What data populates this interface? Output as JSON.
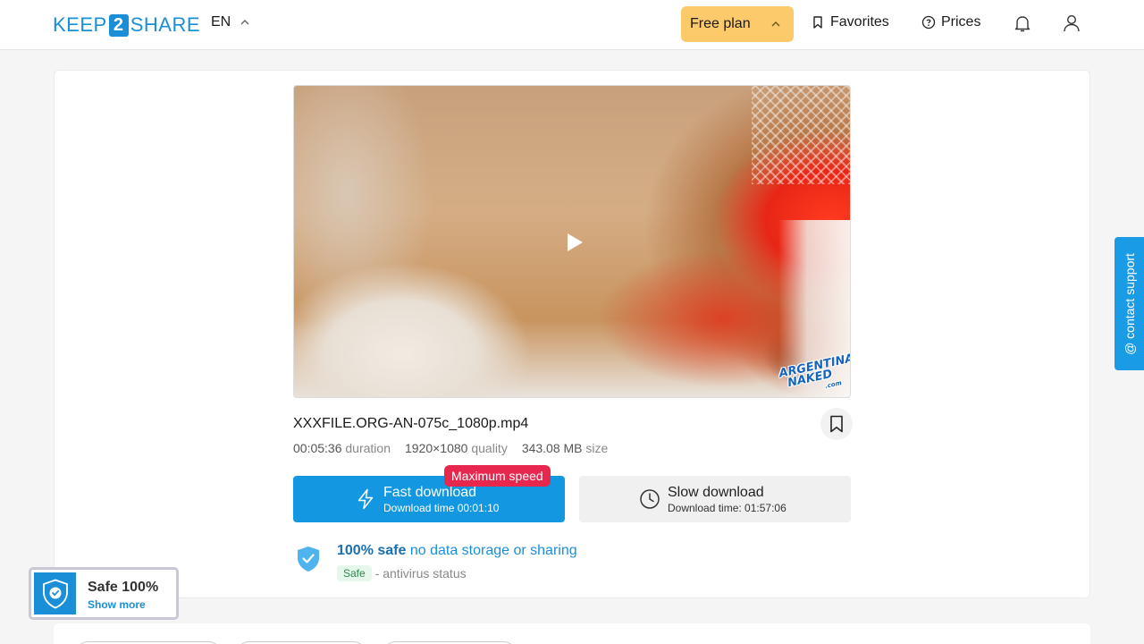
{
  "header": {
    "logo_left": "KEEP",
    "logo_mid": "2",
    "logo_right": "SHARE",
    "language": "EN",
    "plan_label": "Free plan",
    "favorites_label": "Favorites",
    "prices_label": "Prices"
  },
  "file": {
    "name": "XXXFILE.ORG-AN-075c_1080p.mp4",
    "duration_value": "00:05:36",
    "duration_label": "duration",
    "quality_value": "1920×1080",
    "quality_label": "quality",
    "size_value": "343.08 MB",
    "size_label": "size",
    "watermark_line1": "ARGENTINA",
    "watermark_line2": "NAKED",
    "watermark_line3": ".com"
  },
  "download": {
    "max_speed_badge": "Maximum speed",
    "fast_title": "Fast download",
    "fast_subtitle": "Download time 00:01:10",
    "slow_title": "Slow download",
    "slow_subtitle": "Download time: 01:57:06"
  },
  "safety": {
    "bold": "100% safe",
    "rest": "no data storage or sharing",
    "pill": "Safe",
    "status": "- antivirus status"
  },
  "badge": {
    "title": "Safe 100%",
    "link": "Show more"
  },
  "support": {
    "label": "@ contact support"
  },
  "colors": {
    "accent": "#1297e0",
    "plan": "#fcc96b",
    "badge_red": "#e8274f"
  }
}
